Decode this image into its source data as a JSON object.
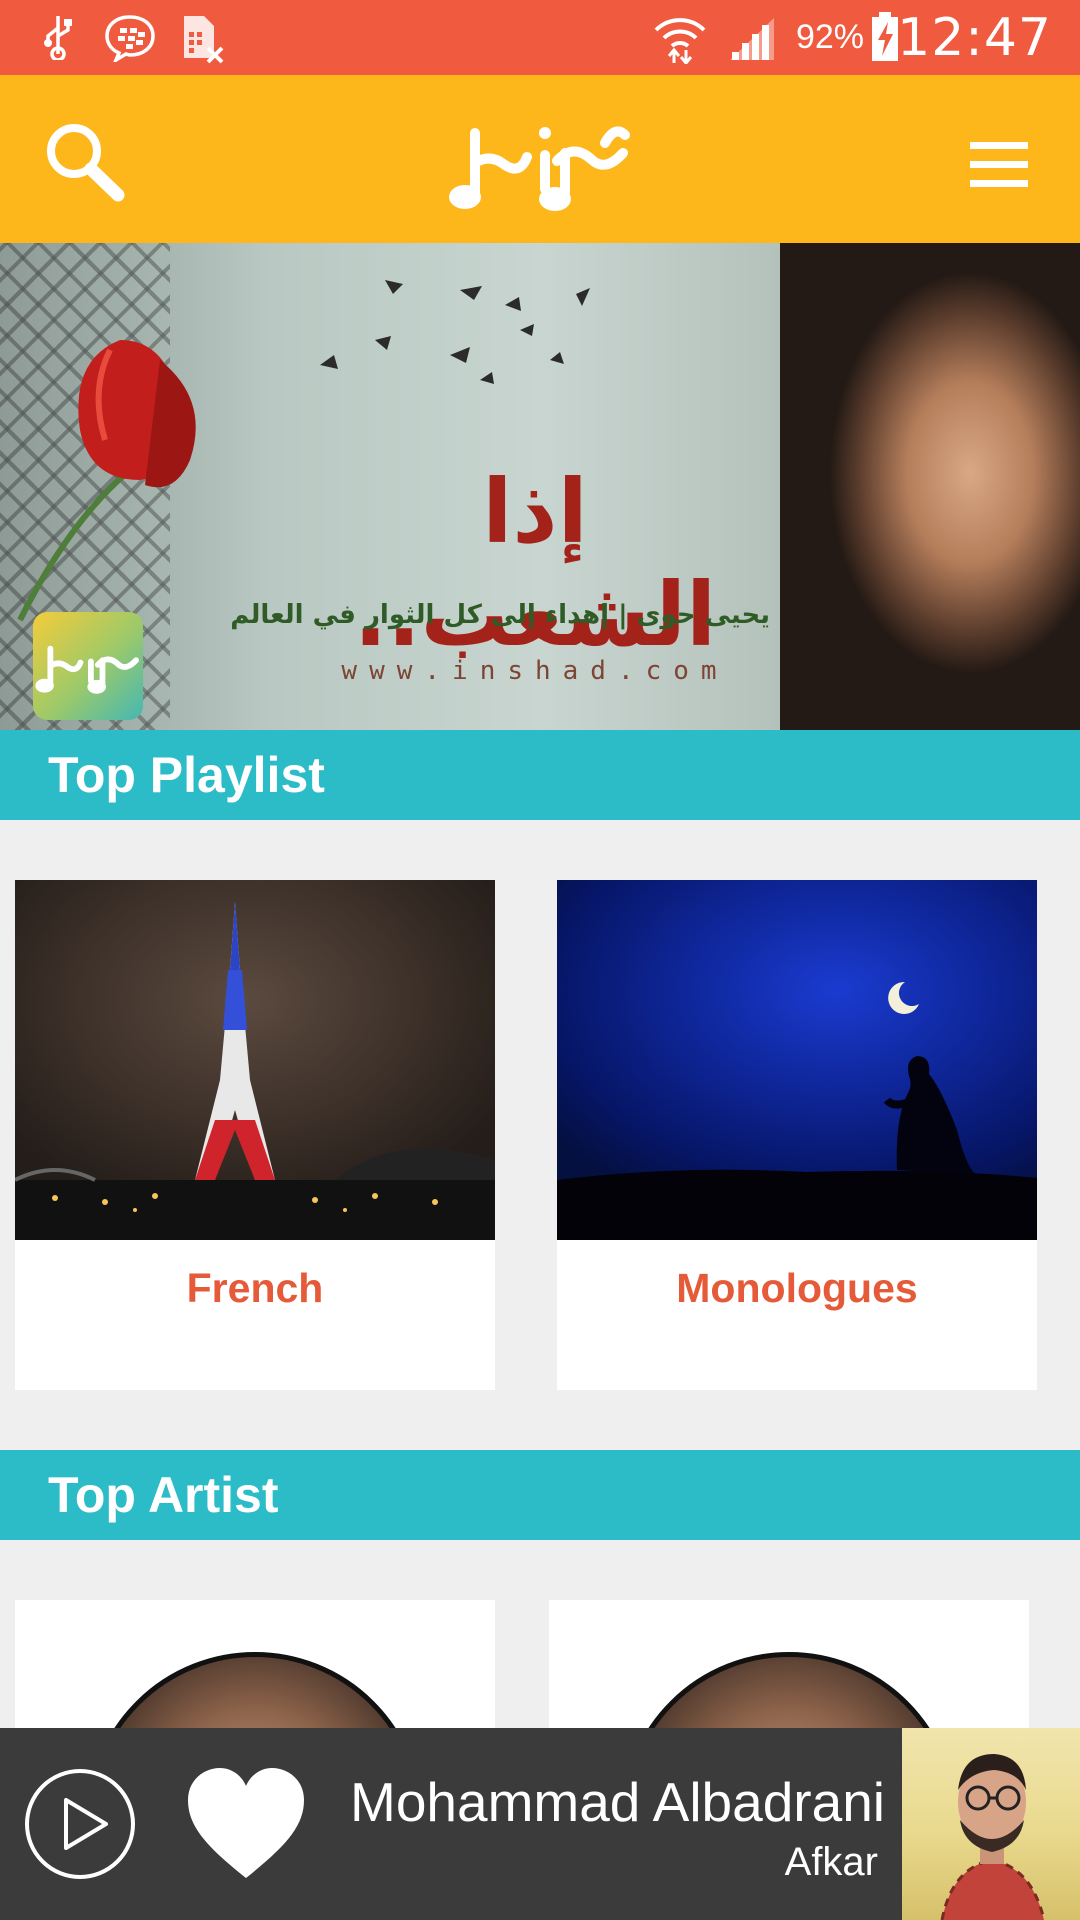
{
  "status_bar": {
    "battery": "92%",
    "time": "12:47",
    "color": "#f05a3f"
  },
  "app_bar": {
    "logo_alt": "مزامير",
    "color": "#fdb71b"
  },
  "banner": {
    "title": "إذا الشعب..",
    "subtitle": "يحيى حوى | إهداء إلى كل الثوار في العالم",
    "url": "www.inshad.com"
  },
  "sections": {
    "top_playlist": "Top Playlist",
    "top_artist": "Top Artist",
    "color": "#2cbcc7"
  },
  "playlists": [
    {
      "label": "French"
    },
    {
      "label": "Monologues"
    }
  ],
  "player": {
    "artist": "Mohammad Albadrani",
    "album": "Afkar"
  }
}
